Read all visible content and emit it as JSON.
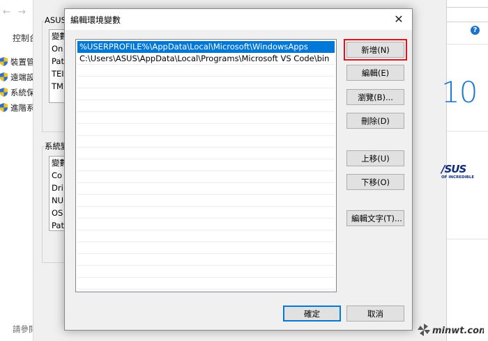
{
  "control_panel": {
    "title": "控制台",
    "items": [
      "裝置管",
      "遠端設",
      "系統保",
      "進階系"
    ],
    "see_also": "請參閱"
  },
  "env_window": {
    "user_group_label": "ASUS",
    "user_vars": [
      "變數",
      "On",
      "Pat",
      "TEI",
      "TM"
    ],
    "system_group_label": "系統變",
    "system_vars": [
      "變數",
      "Co",
      "Dri",
      "NU",
      "OS",
      "Pat"
    ]
  },
  "right_window": {
    "brand_text": "10",
    "asus_logo": "/SUS",
    "asus_tagline": "OF INCREDIBLE"
  },
  "dialog": {
    "title": "編輯環境變數",
    "close_label": "✕",
    "paths": [
      "%USERPROFILE%\\AppData\\Local\\Microsoft\\WindowsApps",
      "C:\\Users\\ASUS\\AppData\\Local\\Programs\\Microsoft VS Code\\bin"
    ],
    "buttons": {
      "new": "新增(N)",
      "edit": "編輯(E)",
      "browse": "瀏覽(B)...",
      "delete": "刪除(D)",
      "move_up": "上移(U)",
      "move_down": "下移(O)",
      "edit_text": "編輯文字(T)...",
      "ok": "確定",
      "cancel": "取消"
    }
  },
  "watermark": "minwt.com",
  "colors": {
    "selection": "#0078d7",
    "highlight_box": "#e0121a",
    "dialog_bg": "#f0f0f0"
  }
}
